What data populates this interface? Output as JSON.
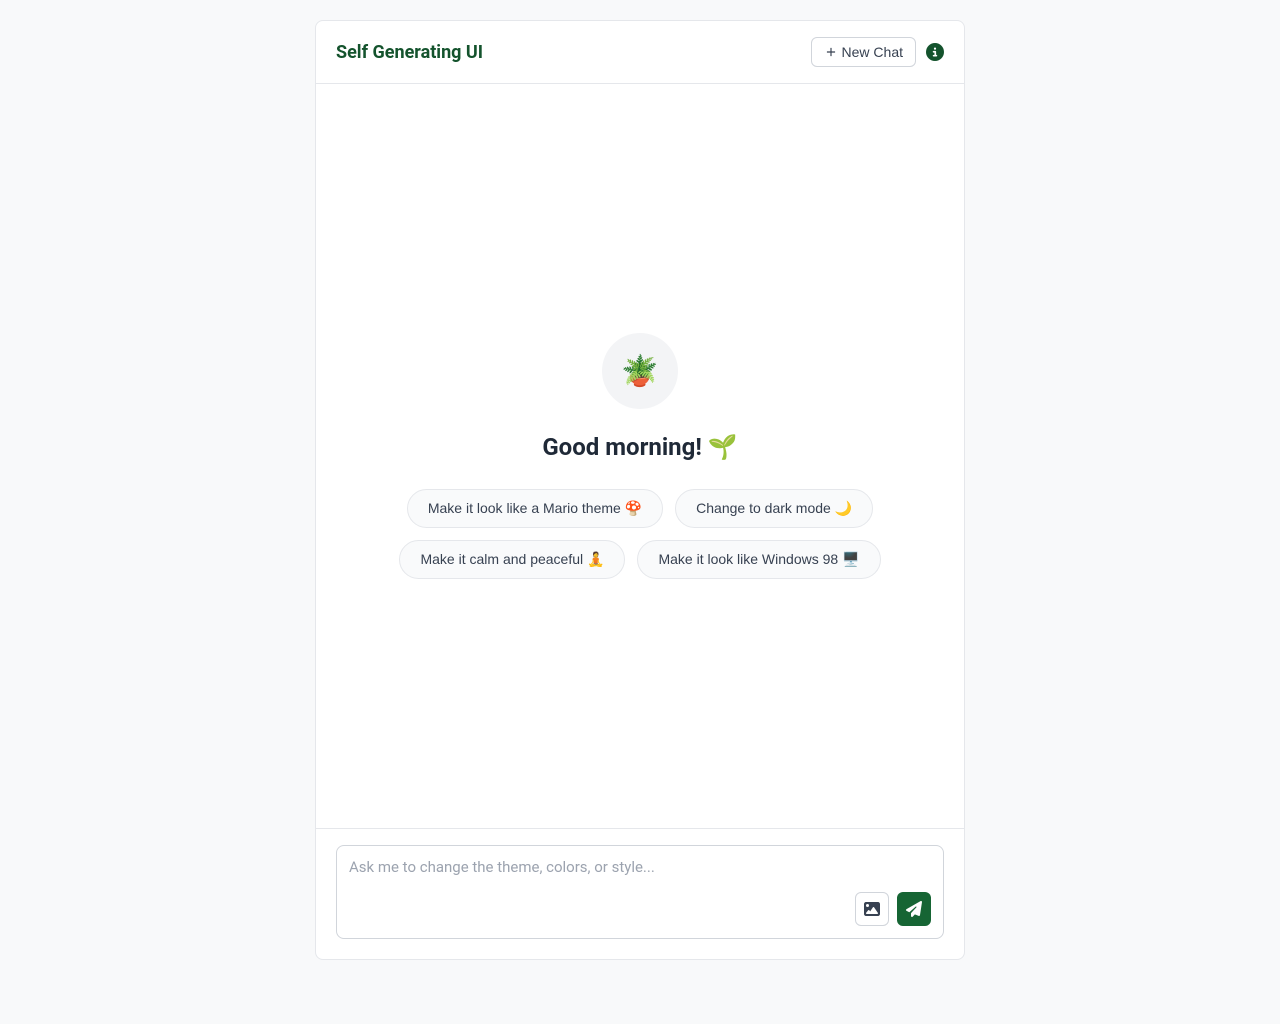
{
  "header": {
    "title": "Self Generating UI",
    "new_chat_label": "New Chat"
  },
  "main": {
    "avatar_emoji": "🪴",
    "greeting": "Good morning! 🌱",
    "suggestions": [
      "Make it look like a Mario theme 🍄",
      "Change to dark mode 🌙",
      "Make it calm and peaceful 🧘",
      "Make it look like Windows 98 🖥️"
    ]
  },
  "footer": {
    "input_placeholder": "Ask me to change the theme, colors, or style..."
  },
  "colors": {
    "brand": "#14532d",
    "send_button": "#166534"
  }
}
